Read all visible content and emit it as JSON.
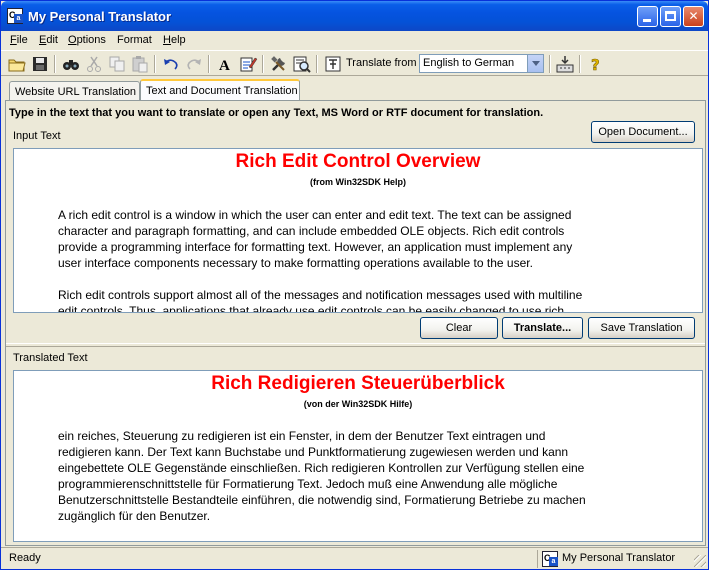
{
  "window": {
    "title": "My Personal Translator"
  },
  "menu": [
    {
      "first": "F",
      "rest": "ile"
    },
    {
      "first": "E",
      "rest": "dit"
    },
    {
      "first": "O",
      "rest": "ptions"
    },
    {
      "first": "",
      "rest": "Format"
    },
    {
      "first": "H",
      "rest": "elp"
    }
  ],
  "toolbar": {
    "translate_from_label": "Translate from",
    "language_pair": "English to German"
  },
  "tabs": [
    {
      "label": "Website URL Translation"
    },
    {
      "label": "Text and Document Translation"
    }
  ],
  "instructions": "Type in the text that you want to translate or open any Text, MS Word or RTF document for translation.",
  "input": {
    "label": "Input Text",
    "open_button": "Open Document...",
    "title": "Rich Edit Control Overview",
    "subtitle": "(from Win32SDK Help)",
    "paragraph1": [
      "A rich edit control is a window in which the user can enter and edit text. The text can be assigned",
      "character and paragraph formatting, and can include embedded OLE objects. Rich edit controls",
      "provide a programming interface for formatting text. However, an application must implement any",
      "user interface components necessary to make formatting operations available to the user."
    ],
    "paragraph2": [
      "Rich edit controls support almost all of the messages and notification messages used with multiline",
      "edit controls. Thus, applications that already use edit controls can be easily changed to use rich"
    ]
  },
  "actions": {
    "clear": "Clear",
    "translate": "Translate...",
    "save": "Save Translation"
  },
  "output": {
    "label": "Translated Text",
    "title": "Rich Redigieren Steuerüberblick",
    "subtitle": "(von der Win32SDK Hilfe)",
    "paragraph1": [
      "ein reiches, Steuerung zu redigieren ist ein Fenster, in dem der Benutzer Text eintragen und",
      "redigieren kann. Der Text kann Buchstabe und Punktformatierung zugewiesen werden und kann",
      "eingebettete OLE Gegenstände einschließen. Rich redigieren Kontrollen zur Verfügung stellen eine",
      "programmierenschnittstelle für Formatierung Text. Jedoch muß eine Anwendung alle mögliche",
      "Benutzerschnittstelle Bestandteile einführen, die notwendig sind, Formatierung Betriebe zu machen",
      "zugänglich für den Benutzer."
    ]
  },
  "status": {
    "left": "Ready",
    "right": "My Personal Translator"
  }
}
